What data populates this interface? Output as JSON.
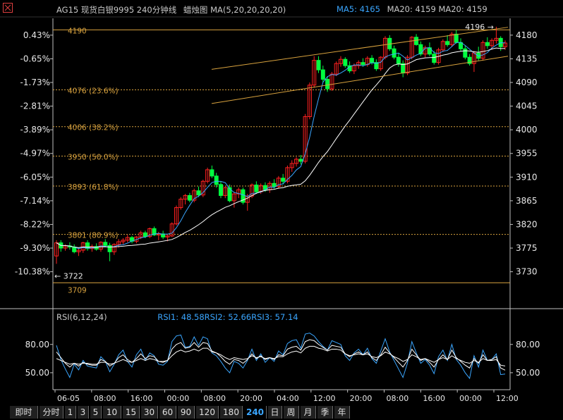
{
  "header": {
    "symbol_title": "AG15 现货白银9995 240分钟线",
    "chart_kind": "蜡烛图",
    "ma_config": "MA(5,20,20,20,20)",
    "ma5_label": "MA5: 4165",
    "ma20_label_a": "MA20: 4159",
    "ma20_label_b": "MA20: 4159",
    "colors": {
      "title": "#c8c8c8",
      "ma5": "#3aa6ff",
      "ma20": "#c8c8c8"
    }
  },
  "corner_icon": "crosshair-square-icon",
  "rsi_header": {
    "title": "RSI(6,12,24)",
    "rsi1": "RSI1: 48.58",
    "rsi2": "RSI2: 52.66",
    "rsi3": "RSI3: 57.14",
    "colors": {
      "rsi1": "#3aa6ff",
      "rsi2": "#ffffff",
      "rsi3": "#ffffff"
    }
  },
  "tabs": [
    "即时",
    "分时",
    "1",
    "3",
    "5",
    "10",
    "15",
    "30",
    "60",
    "90",
    "120",
    "180",
    "240",
    "日",
    "周",
    "月",
    "季",
    "年"
  ],
  "active_tab": "240",
  "chart_data": [
    {
      "type": "candlestick",
      "title": "AG15 现货白银9995 240分钟线",
      "y_ticks_right": [
        4180,
        4135,
        4090,
        4045,
        4000,
        3955,
        3910,
        3865,
        3820,
        3775,
        3730
      ],
      "y_ticks_left": [
        "0.43%",
        "-0.65%",
        "-1.73%",
        "-2.81%",
        "-3.89%",
        "-4.97%",
        "-6.05%",
        "-7.14%",
        "-8.22%",
        "-9.30%",
        "-10.38%"
      ],
      "ylim": [
        3704,
        4212
      ],
      "x_ticks": [
        "06-05",
        "08:00",
        "16:00",
        "00:00",
        "08:00",
        "20:00",
        "04:00",
        "12:00",
        "20:00",
        "08:00",
        "16:00",
        "00:00",
        "12:00"
      ],
      "fibonacci_levels": [
        {
          "price": 4190,
          "label": "4190"
        },
        {
          "price": 4076,
          "label": "4076 (23.6%)"
        },
        {
          "price": 4006,
          "label": "4006 (38.2%)"
        },
        {
          "price": 3950,
          "label": "3950 (50.0%)"
        },
        {
          "price": 3893,
          "label": "3893 (61.8%)"
        },
        {
          "price": 3801,
          "label": "3801 (80.9%)"
        },
        {
          "price": 3709,
          "label": "3709"
        }
      ],
      "annotations": [
        {
          "text": "4196 →",
          "price": 4196
        },
        {
          "text": "← 3722",
          "price": 3722
        }
      ],
      "channel_lines": [
        {
          "from": [
            0,
            4115
          ],
          "to": [
            1,
            4195
          ]
        },
        {
          "from": [
            0,
            4050
          ],
          "to": [
            1,
            4140
          ]
        }
      ],
      "colors": {
        "up": "#ff2020",
        "down": "#00ff40",
        "fib": "#d8a23e",
        "ma5": "#3aa6ff",
        "ma20": "#ffffff",
        "channel": "#d8a23e"
      },
      "ohlc": [
        [
          3760,
          3790,
          3745,
          3785
        ],
        [
          3785,
          3790,
          3768,
          3775
        ],
        [
          3775,
          3782,
          3770,
          3779
        ],
        [
          3779,
          3786,
          3772,
          3777
        ],
        [
          3777,
          3782,
          3765,
          3768
        ],
        [
          3768,
          3775,
          3760,
          3771
        ],
        [
          3771,
          3787,
          3766,
          3785
        ],
        [
          3785,
          3790,
          3770,
          3774
        ],
        [
          3774,
          3782,
          3768,
          3778
        ],
        [
          3778,
          3784,
          3770,
          3773
        ],
        [
          3773,
          3788,
          3768,
          3786
        ],
        [
          3786,
          3792,
          3777,
          3780
        ],
        [
          3780,
          3785,
          3750,
          3768
        ],
        [
          3768,
          3784,
          3762,
          3782
        ],
        [
          3782,
          3792,
          3776,
          3787
        ],
        [
          3787,
          3794,
          3782,
          3790
        ],
        [
          3790,
          3800,
          3786,
          3795
        ],
        [
          3795,
          3798,
          3784,
          3788
        ],
        [
          3788,
          3798,
          3784,
          3796
        ],
        [
          3796,
          3808,
          3792,
          3804
        ],
        [
          3804,
          3808,
          3794,
          3797
        ],
        [
          3797,
          3814,
          3794,
          3812
        ],
        [
          3812,
          3816,
          3798,
          3800
        ],
        [
          3800,
          3806,
          3790,
          3802
        ],
        [
          3802,
          3808,
          3792,
          3796
        ],
        [
          3796,
          3802,
          3788,
          3798
        ],
        [
          3798,
          3824,
          3796,
          3821
        ],
        [
          3821,
          3856,
          3818,
          3852
        ],
        [
          3852,
          3872,
          3848,
          3868
        ],
        [
          3868,
          3878,
          3858,
          3875
        ],
        [
          3875,
          3880,
          3862,
          3866
        ],
        [
          3866,
          3888,
          3862,
          3884
        ],
        [
          3884,
          3892,
          3872,
          3876
        ],
        [
          3876,
          3905,
          3872,
          3902
        ],
        [
          3902,
          3928,
          3898,
          3924
        ],
        [
          3924,
          3932,
          3908,
          3912
        ],
        [
          3912,
          3918,
          3890,
          3896
        ],
        [
          3896,
          3902,
          3870,
          3875
        ],
        [
          3875,
          3892,
          3870,
          3890
        ],
        [
          3890,
          3896,
          3862,
          3865
        ],
        [
          3865,
          3882,
          3852,
          3878
        ],
        [
          3878,
          3890,
          3870,
          3886
        ],
        [
          3886,
          3890,
          3858,
          3862
        ],
        [
          3862,
          3878,
          3846,
          3874
        ],
        [
          3874,
          3898,
          3870,
          3895
        ],
        [
          3895,
          3902,
          3878,
          3882
        ],
        [
          3882,
          3898,
          3878,
          3894
        ],
        [
          3894,
          3900,
          3882,
          3886
        ],
        [
          3886,
          3902,
          3880,
          3898
        ],
        [
          3898,
          3906,
          3888,
          3892
        ],
        [
          3892,
          3912,
          3888,
          3908
        ],
        [
          3908,
          3916,
          3896,
          3902
        ],
        [
          3902,
          3932,
          3898,
          3928
        ],
        [
          3928,
          3942,
          3920,
          3936
        ],
        [
          3936,
          3948,
          3930,
          3944
        ],
        [
          3944,
          3952,
          3934,
          3940
        ],
        [
          3940,
          4030,
          3936,
          4025
        ],
        [
          4025,
          4090,
          4020,
          4085
        ],
        [
          4085,
          4140,
          4080,
          4132
        ],
        [
          4132,
          4140,
          4108,
          4114
        ],
        [
          4114,
          4122,
          4090,
          4096
        ],
        [
          4096,
          4102,
          4072,
          4078
        ],
        [
          4078,
          4110,
          4074,
          4106
        ],
        [
          4106,
          4130,
          4102,
          4126
        ],
        [
          4126,
          4140,
          4120,
          4134
        ],
        [
          4134,
          4138,
          4118,
          4122
        ],
        [
          4122,
          4130,
          4108,
          4112
        ],
        [
          4112,
          4126,
          4106,
          4122
        ],
        [
          4122,
          4132,
          4116,
          4128
        ],
        [
          4128,
          4136,
          4120,
          4124
        ],
        [
          4124,
          4140,
          4120,
          4136
        ],
        [
          4136,
          4142,
          4124,
          4128
        ],
        [
          4128,
          4134,
          4112,
          4116
        ],
        [
          4116,
          4140,
          4112,
          4138
        ],
        [
          4138,
          4178,
          4134,
          4174
        ],
        [
          4174,
          4180,
          4150,
          4154
        ],
        [
          4154,
          4160,
          4134,
          4138
        ],
        [
          4138,
          4146,
          4120,
          4126
        ],
        [
          4126,
          4132,
          4100,
          4108
        ],
        [
          4108,
          4142,
          4104,
          4138
        ],
        [
          4138,
          4178,
          4134,
          4176
        ],
        [
          4176,
          4182,
          4160,
          4162
        ],
        [
          4162,
          4168,
          4140,
          4144
        ],
        [
          4144,
          4160,
          4138,
          4156
        ],
        [
          4156,
          4166,
          4140,
          4144
        ],
        [
          4144,
          4150,
          4124,
          4128
        ],
        [
          4128,
          4156,
          4124,
          4152
        ],
        [
          4152,
          4172,
          4148,
          4168
        ],
        [
          4168,
          4180,
          4158,
          4162
        ],
        [
          4162,
          4186,
          4158,
          4182
        ],
        [
          4182,
          4190,
          4164,
          4166
        ],
        [
          4166,
          4174,
          4150,
          4154
        ],
        [
          4154,
          4160,
          4134,
          4138
        ],
        [
          4138,
          4144,
          4122,
          4126
        ],
        [
          4126,
          4150,
          4110,
          4146
        ],
        [
          4146,
          4158,
          4132,
          4136
        ],
        [
          4136,
          4170,
          4132,
          4166
        ],
        [
          4166,
          4176,
          4154,
          4160
        ],
        [
          4160,
          4174,
          4152,
          4170
        ],
        [
          4170,
          4196,
          4164,
          4174
        ],
        [
          4174,
          4178,
          4150,
          4158
        ],
        [
          4158,
          4170,
          4152,
          4165
        ]
      ]
    },
    {
      "type": "line",
      "title": "RSI(6,12,24)",
      "y_ticks": [
        80,
        50
      ],
      "ylim": [
        32,
        97
      ],
      "series": [
        {
          "name": "RSI1",
          "color": "#3aa6ff",
          "values": [
            79,
            64,
            54,
            45,
            59,
            53,
            63,
            57,
            56,
            55,
            67,
            62,
            51,
            59,
            69,
            74,
            62,
            56,
            69,
            75,
            63,
            71,
            68,
            59,
            58,
            62,
            83,
            89,
            90,
            77,
            78,
            88,
            79,
            88,
            86,
            71,
            68,
            62,
            55,
            50,
            62,
            60,
            55,
            63,
            75,
            63,
            70,
            61,
            66,
            62,
            73,
            69,
            81,
            84,
            85,
            76,
            91,
            92,
            89,
            83,
            78,
            74,
            84,
            82,
            80,
            68,
            63,
            71,
            75,
            69,
            76,
            65,
            60,
            73,
            86,
            72,
            63,
            54,
            45,
            60,
            83,
            71,
            60,
            64,
            58,
            49,
            67,
            74,
            63,
            80,
            64,
            58,
            50,
            44,
            68,
            56,
            74,
            63,
            64,
            70,
            48,
            48.58
          ]
        },
        {
          "name": "RSI2",
          "color": "#ffffff",
          "values": [
            72,
            66,
            60,
            56,
            60,
            57,
            61,
            59,
            58,
            58,
            64,
            62,
            57,
            60,
            66,
            69,
            64,
            61,
            65,
            70,
            65,
            68,
            67,
            62,
            61,
            63,
            75,
            80,
            82,
            76,
            77,
            82,
            77,
            82,
            81,
            73,
            71,
            67,
            62,
            59,
            64,
            63,
            60,
            64,
            70,
            65,
            68,
            64,
            66,
            64,
            69,
            68,
            75,
            77,
            78,
            74,
            83,
            85,
            84,
            80,
            77,
            74,
            79,
            78,
            77,
            70,
            67,
            70,
            72,
            69,
            72,
            66,
            63,
            69,
            77,
            71,
            66,
            61,
            56,
            63,
            75,
            69,
            63,
            65,
            61,
            56,
            64,
            69,
            64,
            74,
            66,
            62,
            58,
            55,
            65,
            60,
            69,
            63,
            64,
            67,
            55,
            52.66
          ]
        },
        {
          "name": "RSI3",
          "color": "#ffffff",
          "values": [
            65,
            63,
            61,
            59,
            60,
            59,
            60,
            60,
            59,
            59,
            61,
            61,
            59,
            60,
            62,
            64,
            62,
            61,
            63,
            65,
            63,
            65,
            64,
            62,
            62,
            63,
            68,
            72,
            74,
            72,
            73,
            75,
            73,
            76,
            76,
            72,
            71,
            69,
            66,
            64,
            66,
            65,
            64,
            65,
            68,
            66,
            67,
            65,
            66,
            65,
            67,
            67,
            70,
            72,
            73,
            71,
            76,
            78,
            78,
            76,
            75,
            73,
            75,
            75,
            74,
            70,
            68,
            69,
            70,
            69,
            70,
            67,
            66,
            68,
            72,
            70,
            67,
            65,
            62,
            64,
            69,
            67,
            64,
            65,
            63,
            61,
            64,
            66,
            64,
            68,
            65,
            63,
            61,
            60,
            63,
            61,
            65,
            63,
            63,
            64,
            58,
            57.14
          ]
        }
      ]
    }
  ]
}
